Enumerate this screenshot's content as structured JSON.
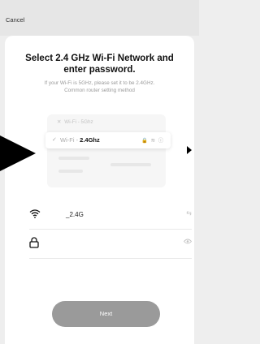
{
  "header": {
    "cancel_label": "Cancel"
  },
  "main": {
    "title": "Select 2.4 GHz Wi-Fi Network and enter password.",
    "subtitle_line1": "If your Wi-Fi is 5GHz, please set it to be 2.4GHz.",
    "subtitle_line2": "Common router setting method"
  },
  "illustration": {
    "row1_mark": "✕",
    "row1_label": "Wi-Fi - 5Ghz",
    "selected_prefix": "Wi-Fi - ",
    "selected_band": "2.4Ghz",
    "selected_icons": "🔒 ≋ ⓘ"
  },
  "wifi_field": {
    "icon": "wifi-icon",
    "value": "_2.4G",
    "switch_icon": "swap-icon"
  },
  "password_field": {
    "icon": "lock-icon",
    "value": "",
    "toggle_icon": "eye-icon"
  },
  "footer": {
    "next_label": "Next"
  },
  "colors": {
    "background": "#eeeeee",
    "card": "#ffffff",
    "next_button": "#9a9a9a",
    "muted_text": "#9a9a9a"
  }
}
